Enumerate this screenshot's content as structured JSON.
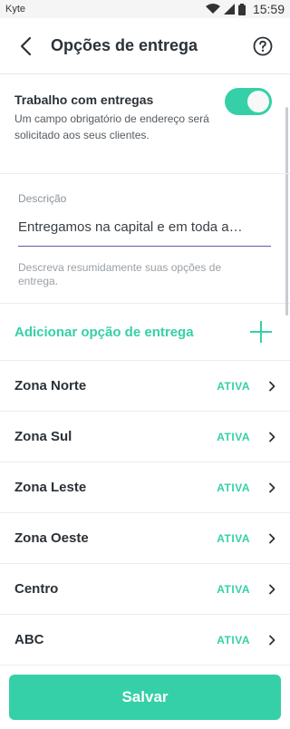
{
  "status_bar": {
    "carrier": "Kyte",
    "time": "15:59"
  },
  "header": {
    "title": "Opções de entrega",
    "back_icon": "arrow-left-icon",
    "help_icon": "question-circle-icon"
  },
  "delivery_toggle": {
    "title": "Trabalho com entregas",
    "description": "Um campo obrigatório de endereço será solicitado aos seus clientes.",
    "enabled": true
  },
  "description": {
    "label": "Descrição",
    "value": "Entregamos na capital e em toda a…",
    "hint": "Descreva resumidamente suas opções de entrega."
  },
  "add_option": {
    "label": "Adicionar opção de entrega"
  },
  "zones": [
    {
      "name": "Zona Norte",
      "status": "ATIVA"
    },
    {
      "name": "Zona Sul",
      "status": "ATIVA"
    },
    {
      "name": "Zona Leste",
      "status": "ATIVA"
    },
    {
      "name": "Zona Oeste",
      "status": "ATIVA"
    },
    {
      "name": "Centro",
      "status": "ATIVA"
    },
    {
      "name": "ABC",
      "status": "ATIVA"
    }
  ],
  "footer": {
    "save_label": "Salvar"
  },
  "colors": {
    "accent": "#35d0a7",
    "text": "#2b3137",
    "input_underline": "#6c57a8"
  }
}
